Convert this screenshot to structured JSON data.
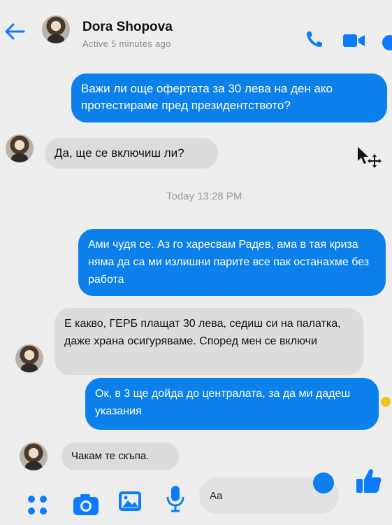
{
  "header": {
    "contact_name": "Dora Shopova",
    "status": "Active 5 minutes ago"
  },
  "messages": [
    {
      "direction": "outgoing",
      "text": "Важи ли още офертата за 30 лева на ден ако протестираме пред президентството?"
    },
    {
      "direction": "incoming",
      "text": "Да, ще се включиш ли?"
    },
    {
      "direction": "outgoing",
      "text": "Ами чудя се. Аз го харесвам Радев, ама в тая криза няма да са ми излишни парите все пак останахме без работа"
    },
    {
      "direction": "incoming",
      "text": "Е какво, ГЕРБ плащат 30 лева, седиш си на палатка, даже храна осигуряваме. Според мен се включи"
    },
    {
      "direction": "outgoing",
      "text": "Ок, в 3 ще дойда до централата, за да ми дадеш указания"
    },
    {
      "direction": "incoming",
      "text": "Чакам те скъпа."
    }
  ],
  "timestamp": "Today 13:28 PM",
  "composer": {
    "placeholder": "Aa"
  },
  "colors": {
    "accent": "#0b7fea",
    "incoming_bubble": "#dcdcde",
    "background": "#ededee"
  }
}
